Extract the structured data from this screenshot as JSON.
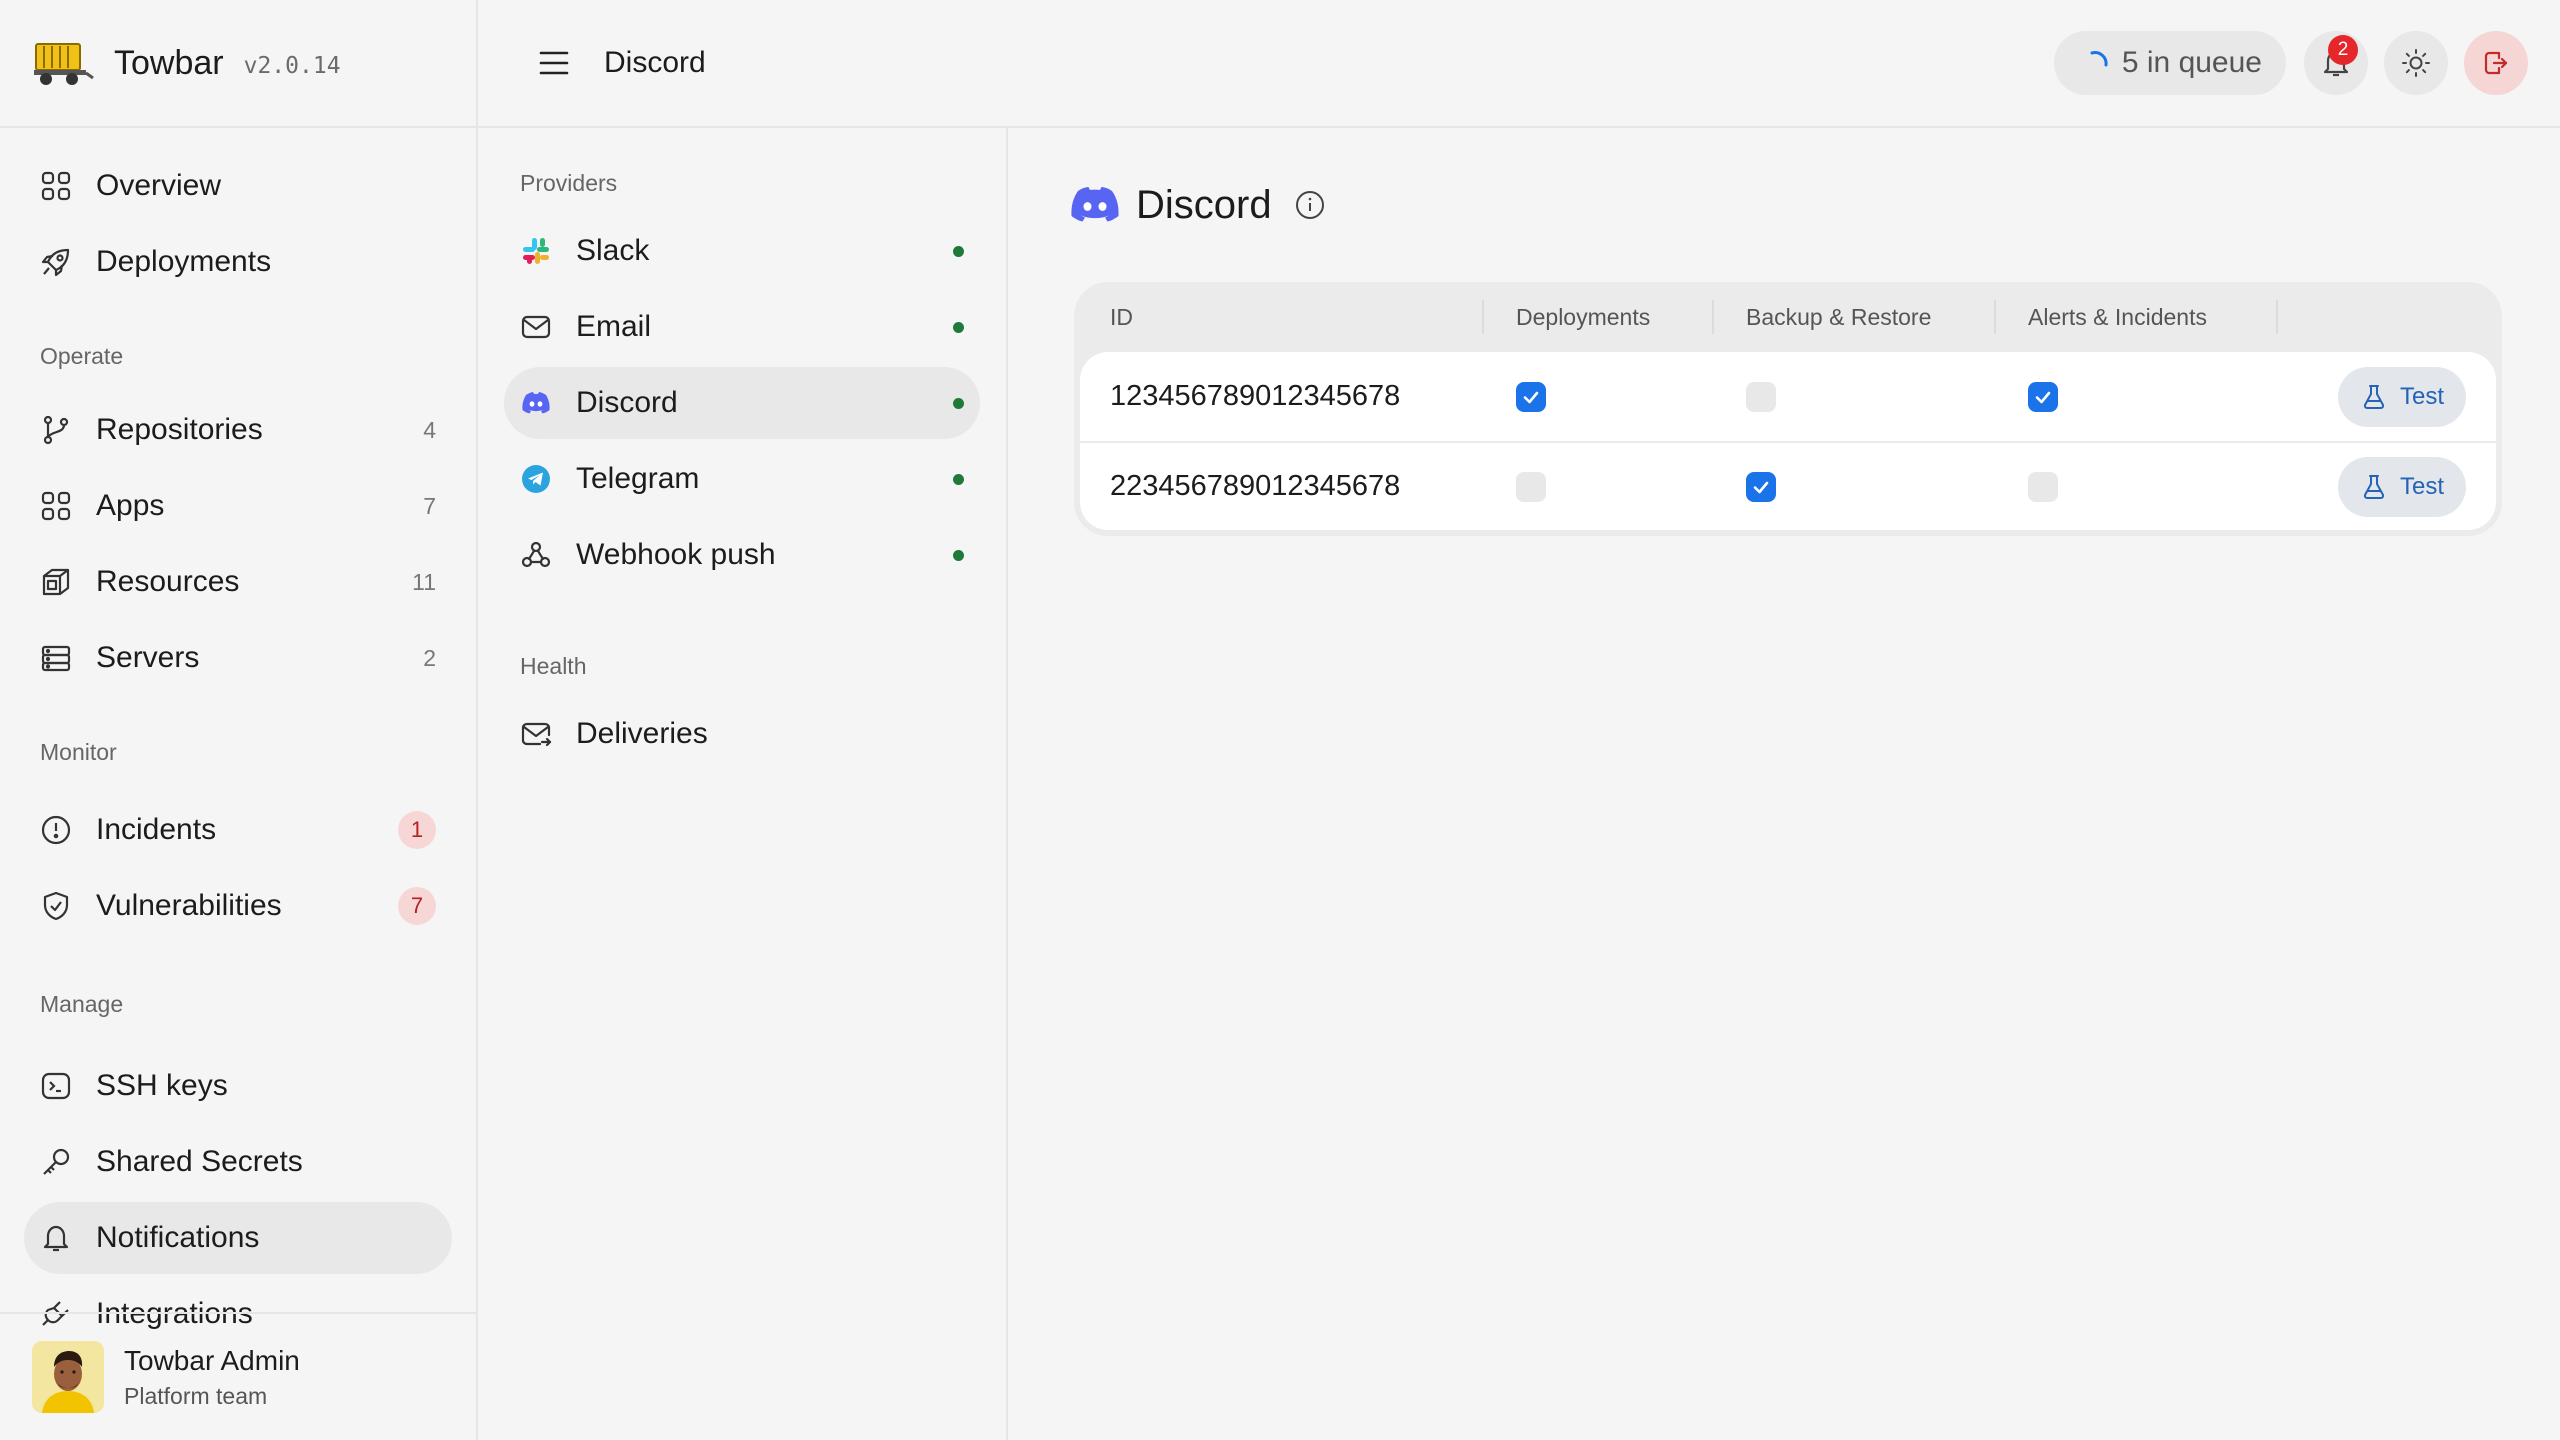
{
  "app": {
    "name": "Towbar",
    "version": "v2.0.14"
  },
  "sidebar": {
    "top_items": [
      {
        "label": "Overview",
        "icon": "grid-icon"
      },
      {
        "label": "Deployments",
        "icon": "rocket-icon"
      }
    ],
    "groups": {
      "operate": {
        "label": "Operate",
        "items": [
          {
            "label": "Repositories",
            "count": "4",
            "icon": "git-branch-icon"
          },
          {
            "label": "Apps",
            "count": "7",
            "icon": "grid-icon"
          },
          {
            "label": "Resources",
            "count": "11",
            "icon": "cube-icon"
          },
          {
            "label": "Servers",
            "count": "2",
            "icon": "server-icon"
          }
        ]
      },
      "monitor": {
        "label": "Monitor",
        "items": [
          {
            "label": "Incidents",
            "count": "1",
            "icon": "alert-circle-icon"
          },
          {
            "label": "Vulnerabilities",
            "count": "7",
            "icon": "shield-icon"
          }
        ]
      },
      "manage": {
        "label": "Manage",
        "items": [
          {
            "label": "SSH keys",
            "icon": "terminal-icon"
          },
          {
            "label": "Shared Secrets",
            "icon": "key-icon"
          },
          {
            "label": "Notifications",
            "icon": "bell-icon",
            "active": true
          },
          {
            "label": "Integrations",
            "icon": "plug-icon"
          }
        ]
      }
    },
    "user": {
      "name": "Towbar Admin",
      "team": "Platform team"
    }
  },
  "header": {
    "title": "Discord",
    "queue_label": "5 in queue",
    "notification_count": "2"
  },
  "subnav": {
    "providers_label": "Providers",
    "providers": [
      {
        "label": "Slack",
        "icon": "slack-icon",
        "status": "active"
      },
      {
        "label": "Email",
        "icon": "mail-icon",
        "status": "active"
      },
      {
        "label": "Discord",
        "icon": "discord-icon",
        "status": "active",
        "active": true
      },
      {
        "label": "Telegram",
        "icon": "telegram-icon",
        "status": "active"
      },
      {
        "label": "Webhook push",
        "icon": "webhook-icon",
        "status": "active"
      }
    ],
    "health_label": "Health",
    "health": [
      {
        "label": "Deliveries",
        "icon": "mail-arrow-icon"
      }
    ]
  },
  "main": {
    "title": "Discord",
    "table": {
      "columns": [
        "ID",
        "Deployments",
        "Backup & Restore",
        "Alerts & Incidents"
      ],
      "rows": [
        {
          "id": "123456789012345678",
          "deployments": true,
          "backup_restore": false,
          "alerts_incidents": true,
          "action": "Test"
        },
        {
          "id": "223456789012345678",
          "deployments": false,
          "backup_restore": true,
          "alerts_incidents": false,
          "action": "Test"
        }
      ]
    }
  },
  "colors": {
    "accent": "#1a73e8",
    "discord": "#5865f2",
    "status_dot": "#1f7a3a",
    "danger_badge": "#e5262b"
  }
}
